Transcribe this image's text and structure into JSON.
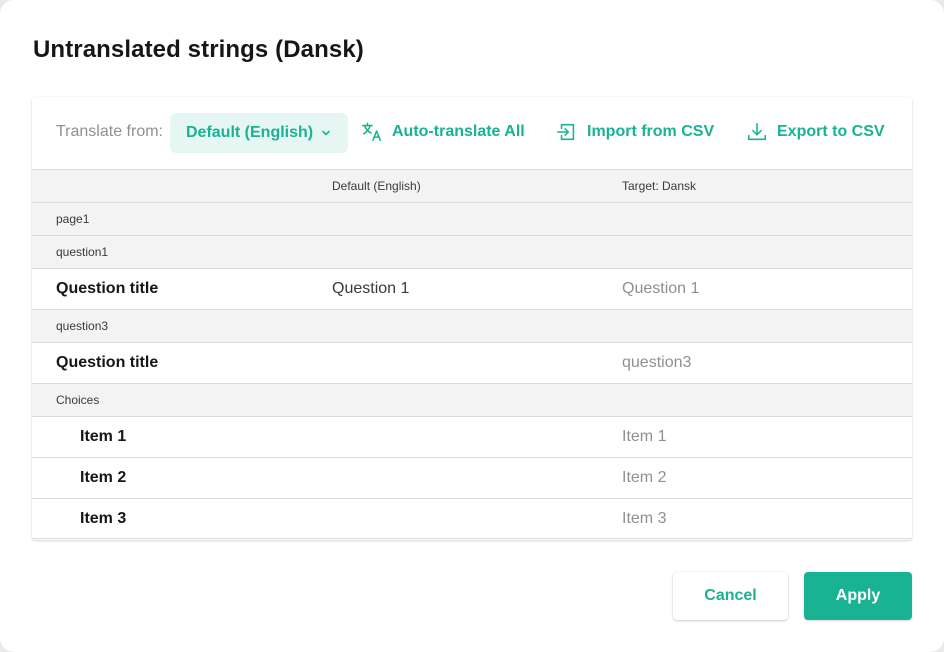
{
  "dialog": {
    "title": "Untranslated strings (Dansk)"
  },
  "toolbar": {
    "translate_from_label": "Translate from:",
    "source_language": "Default (English)",
    "auto_translate_label": "Auto-translate All",
    "import_label": "Import from CSV",
    "export_label": "Export to CSV"
  },
  "table": {
    "columns": [
      "",
      "Default (English)",
      "Target: Dansk"
    ],
    "rows": [
      {
        "kind": "group",
        "name": "page1"
      },
      {
        "kind": "group",
        "name": "question1"
      },
      {
        "kind": "item",
        "name": "Question title",
        "source": "Question 1",
        "target": "Question 1"
      },
      {
        "kind": "group",
        "name": "question3"
      },
      {
        "kind": "item",
        "name": "Question title",
        "source": "",
        "target": "question3"
      },
      {
        "kind": "group",
        "name": "Choices"
      },
      {
        "kind": "item",
        "name": "Item 1",
        "source": "",
        "target": "Item 1"
      },
      {
        "kind": "item",
        "name": "Item 2",
        "source": "",
        "target": "Item 2"
      },
      {
        "kind": "item",
        "name": "Item 3",
        "source": "",
        "target": "Item 3"
      }
    ]
  },
  "footer": {
    "cancel_label": "Cancel",
    "apply_label": "Apply"
  },
  "colors": {
    "accent": "#19b394",
    "accent_light": "#e6f6f2",
    "muted_text": "#909090",
    "row_group_bg": "#f3f3f3"
  },
  "icons": [
    "chevron-down-icon",
    "translate-icon",
    "import-icon",
    "download-icon"
  ]
}
